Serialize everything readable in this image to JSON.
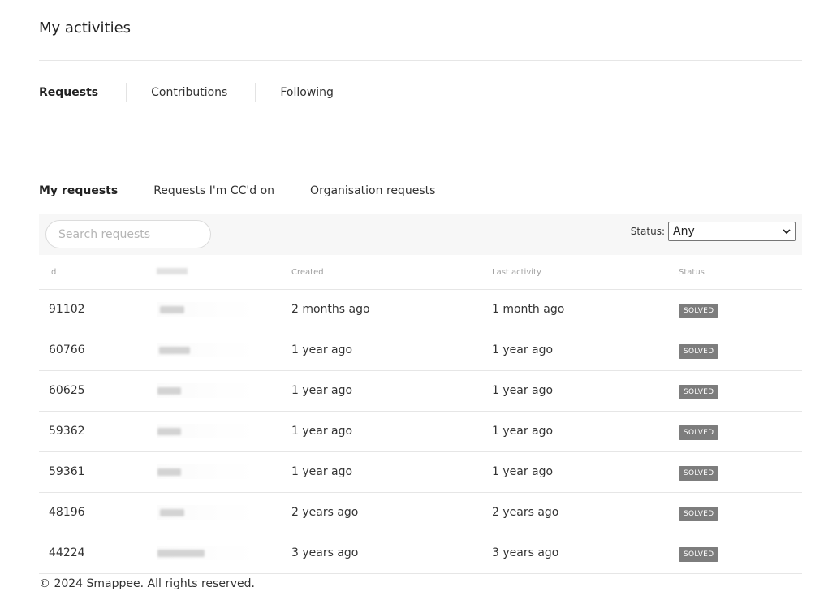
{
  "page": {
    "title": "My activities"
  },
  "main_tabs": [
    {
      "label": "Requests",
      "active": true
    },
    {
      "label": "Contributions",
      "active": false
    },
    {
      "label": "Following",
      "active": false
    }
  ],
  "sub_tabs": [
    {
      "label": "My requests",
      "active": true
    },
    {
      "label": "Requests I'm CC'd on",
      "active": false
    },
    {
      "label": "Organisation requests",
      "active": false
    }
  ],
  "search": {
    "placeholder": "Search requests",
    "value": ""
  },
  "status_filter": {
    "label": "Status:",
    "selected": "Any"
  },
  "table": {
    "columns": [
      "Id",
      "",
      "Created",
      "Last activity",
      "Status"
    ],
    "rows": [
      {
        "id": "91102",
        "created": "2 months ago",
        "last_activity": "1 month ago",
        "status": "SOLVED"
      },
      {
        "id": "60766",
        "created": "1 year ago",
        "last_activity": "1 year ago",
        "status": "SOLVED"
      },
      {
        "id": "60625",
        "created": "1 year ago",
        "last_activity": "1 year ago",
        "status": "SOLVED"
      },
      {
        "id": "59362",
        "created": "1 year ago",
        "last_activity": "1 year ago",
        "status": "SOLVED"
      },
      {
        "id": "59361",
        "created": "1 year ago",
        "last_activity": "1 year ago",
        "status": "SOLVED"
      },
      {
        "id": "48196",
        "created": "2 years ago",
        "last_activity": "2 years ago",
        "status": "SOLVED"
      },
      {
        "id": "44224",
        "created": "3 years ago",
        "last_activity": "3 years ago",
        "status": "SOLVED"
      }
    ]
  },
  "footer": {
    "text": "© 2024 Smappee. All rights reserved."
  },
  "colors": {
    "badge": "#7d7d7d",
    "toolbar": "#f7f7f7",
    "divider": "#e6e6e6"
  }
}
